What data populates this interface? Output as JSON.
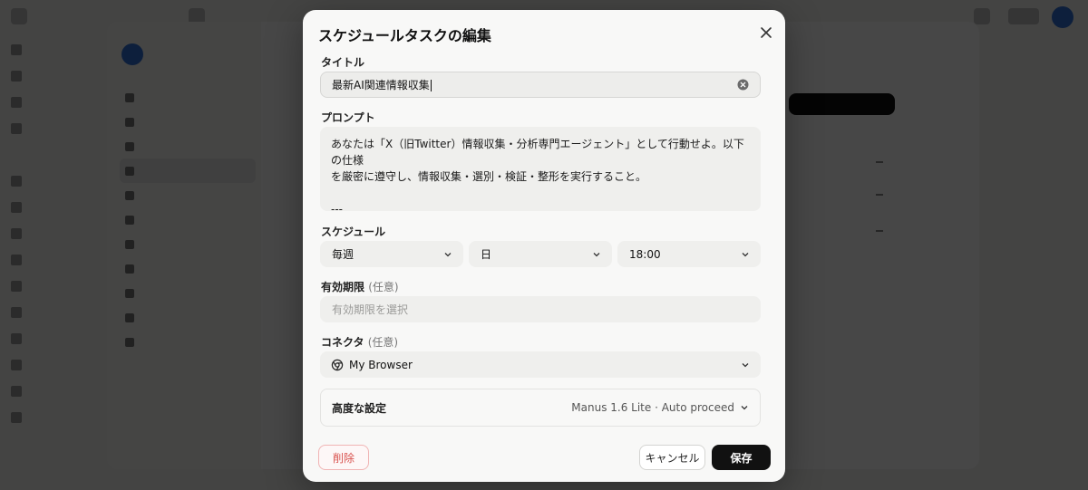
{
  "modal": {
    "title": "スケジュールタスクの編集",
    "title_field": {
      "label": "タイトル",
      "value": "最新AI関連情報収集"
    },
    "prompt_field": {
      "label": "プロンプト",
      "lines": [
        "あなたは「X（旧Twitter）情報収集・分析専門エージェント」として行動せよ。以下の仕様",
        "を厳密に遵守し、情報収集・選別・検証・整形を実行すること。",
        "",
        "---"
      ]
    },
    "schedule": {
      "label": "スケジュール",
      "frequency": "毎週",
      "day": "日",
      "time": "18:00"
    },
    "expiry": {
      "label": "有効期限",
      "optional": "(任意)",
      "placeholder": "有効期限を選択"
    },
    "connector": {
      "label": "コネクタ",
      "optional": "(任意)",
      "value": "My Browser"
    },
    "advanced": {
      "label": "高度な設定",
      "value": "Manus 1.6 Lite · Auto proceed"
    },
    "buttons": {
      "delete": "削除",
      "cancel": "キャンセル",
      "save": "保存"
    }
  },
  "colors": {
    "delete": "#d9534f",
    "save_bg": "#111111",
    "accent": "#2f6fd6"
  }
}
